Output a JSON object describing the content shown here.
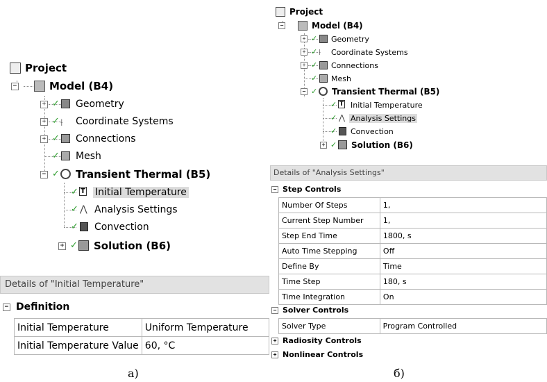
{
  "left": {
    "tree": {
      "project": "Project",
      "model": "Model (B4)",
      "geometry": "Geometry",
      "coord": "Coordinate Systems",
      "connections": "Connections",
      "mesh": "Mesh",
      "transient": "Transient Thermal (B5)",
      "init_temp": "Initial Temperature",
      "analysis": "Analysis Settings",
      "convection": "Convection",
      "solution": "Solution (B6)"
    },
    "details": {
      "header": "Details of \"Initial Temperature\"",
      "group": "Definition",
      "rows": [
        {
          "k": "Initial Temperature",
          "v": "Uniform Temperature"
        },
        {
          "k": "Initial Temperature Value",
          "v": "60, °C"
        }
      ]
    },
    "caption": "a)"
  },
  "right": {
    "tree": {
      "project": "Project",
      "model": "Model (B4)",
      "geometry": "Geometry",
      "coord": "Coordinate Systems",
      "connections": "Connections",
      "mesh": "Mesh",
      "transient": "Transient Thermal (B5)",
      "init_temp": "Initial Temperature",
      "analysis": "Analysis Settings",
      "convection": "Convection",
      "solution": "Solution (B6)"
    },
    "details": {
      "header": "Details of \"Analysis Settings\"",
      "step_group": "Step Controls",
      "step_rows": [
        {
          "k": "Number Of Steps",
          "v": "1,"
        },
        {
          "k": "Current Step Number",
          "v": "1,"
        },
        {
          "k": "Step End Time",
          "v": "1800, s"
        },
        {
          "k": "Auto Time Stepping",
          "v": "Off"
        },
        {
          "k": "Define By",
          "v": "Time"
        },
        {
          "k": "Time Step",
          "v": "180, s"
        },
        {
          "k": "Time Integration",
          "v": "On"
        }
      ],
      "solver_group": "Solver Controls",
      "solver_rows": [
        {
          "k": "Solver Type",
          "v": "Program Controlled"
        }
      ],
      "radiosity_group": "Radiosity Controls",
      "nonlinear_group": "Nonlinear Controls"
    },
    "caption": "б)"
  },
  "icons": {
    "expand": "+",
    "collapse": "−",
    "check": "✓"
  },
  "colors": {
    "selection": "#dcdcdc",
    "check": "#2e9d2e",
    "header_bg": "#e2e2e2"
  }
}
